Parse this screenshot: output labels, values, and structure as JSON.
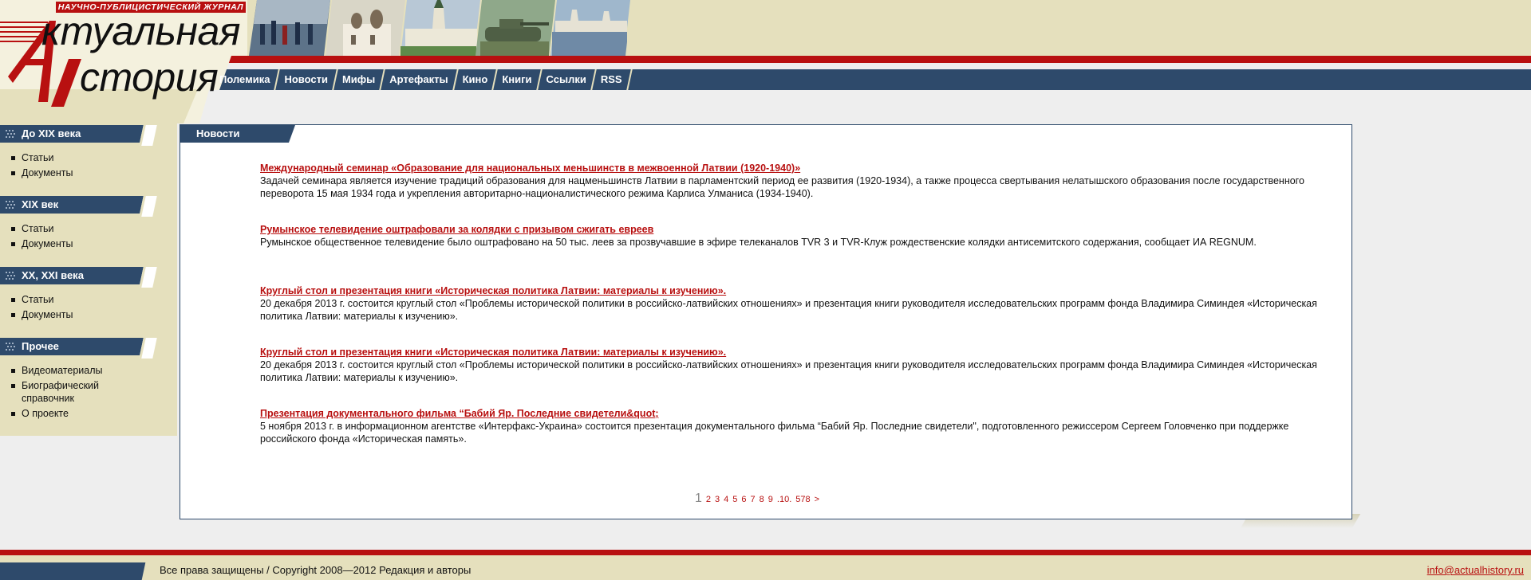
{
  "header": {
    "tagline": "НАУЧНО-ПУБЛИЦИСТИЧЕСКИЙ ЖУРНАЛ",
    "logo_line1": "ктуальная",
    "logo_line2": "стория",
    "photos": [
      "soldiers-painting",
      "church",
      "monastery-walls",
      "tank",
      "kremlin-river"
    ]
  },
  "top_nav": {
    "items": [
      {
        "label": "Полемика"
      },
      {
        "label": "Новости"
      },
      {
        "label": "Мифы"
      },
      {
        "label": "Артефакты"
      },
      {
        "label": "Кино"
      },
      {
        "label": "Книги"
      },
      {
        "label": "Ссылки"
      },
      {
        "label": "RSS"
      }
    ]
  },
  "sidebar": {
    "sections": [
      {
        "title": "До XIX века",
        "items": [
          "Статьи",
          "Документы"
        ]
      },
      {
        "title": "XIX век",
        "items": [
          "Статьи",
          "Документы"
        ]
      },
      {
        "title": "XX, XXI века",
        "items": [
          "Статьи",
          "Документы"
        ]
      },
      {
        "title": "Прочее",
        "items": [
          "Видеоматериалы",
          "Биографический справочник",
          "О проекте"
        ]
      }
    ]
  },
  "main": {
    "tab_title": "Новости",
    "news": [
      {
        "title": "Международный семинар «Образование для национальных меньшинств в межвоенной Латвии (1920-1940)»",
        "text": "Задачей семинара является изучение традиций образования для нацменьшинств Латвии в парламентский период ее развития (1920-1934), а также процесса свертывания нелатышского образования после государственного переворота 15 мая 1934 года и укрепления авторитарно-националистического режима Карлиса Улманиса (1934-1940)."
      },
      {
        "title": "Румынское телевидение оштрафовали за колядки с призывом сжигать евреев",
        "text": "Румынское общественное телевидение было оштрафовано на 50 тыс. леев за прозвучавшие в эфире телеканалов TVR 3 и TVR-Клуж рождественские колядки антисемитского содержания, сообщает ИА REGNUM."
      },
      {
        "title": "Круглый стол и презентация книги «Историческая политика Латвии: материалы к изучению».",
        "text": "20 декабря 2013 г. состоится круглый стол «Проблемы исторической политики в российско-латвийских отношениях» и презентация книги руководителя исследовательских программ фонда Владимира Симиндея «Историческая политика Латвии: материалы к изучению»."
      },
      {
        "title": "Круглый стол и презентация книги «Историческая политика Латвии: материалы к изучению».",
        "text": "20 декабря 2013 г. состоится круглый стол «Проблемы исторической политики в российско-латвийских отношениях» и презентация книги руководителя исследовательских программ фонда Владимира Симиндея «Историческая политика Латвии: материалы к изучению»."
      },
      {
        "title": "Презентация документального фильма “Бабий Яр. Последние свидетели&quot;",
        "text": "5 ноября 2013 г. в информационном агентстве «Интерфакс-Украина» состоится презентация документального фильма “Бабий Яр. Последние свидетели\", подготовленного режиссером Сергеем Головченко при поддержке российского фонда «Историческая память»."
      }
    ],
    "pager": {
      "current": "1",
      "pages": [
        "2",
        "3",
        "4",
        "5",
        "6",
        "7",
        "8",
        "9",
        ".10.",
        "578",
        ">"
      ]
    }
  },
  "footer": {
    "copyright": "Все права защищены / Copyright 2008—2012 Редакция и авторы",
    "email": "info@actualhistory.ru"
  },
  "colors": {
    "navy": "#2e4a6b",
    "red": "#b81010",
    "beige": "#e5e0bd",
    "background": "#eeeeee"
  }
}
